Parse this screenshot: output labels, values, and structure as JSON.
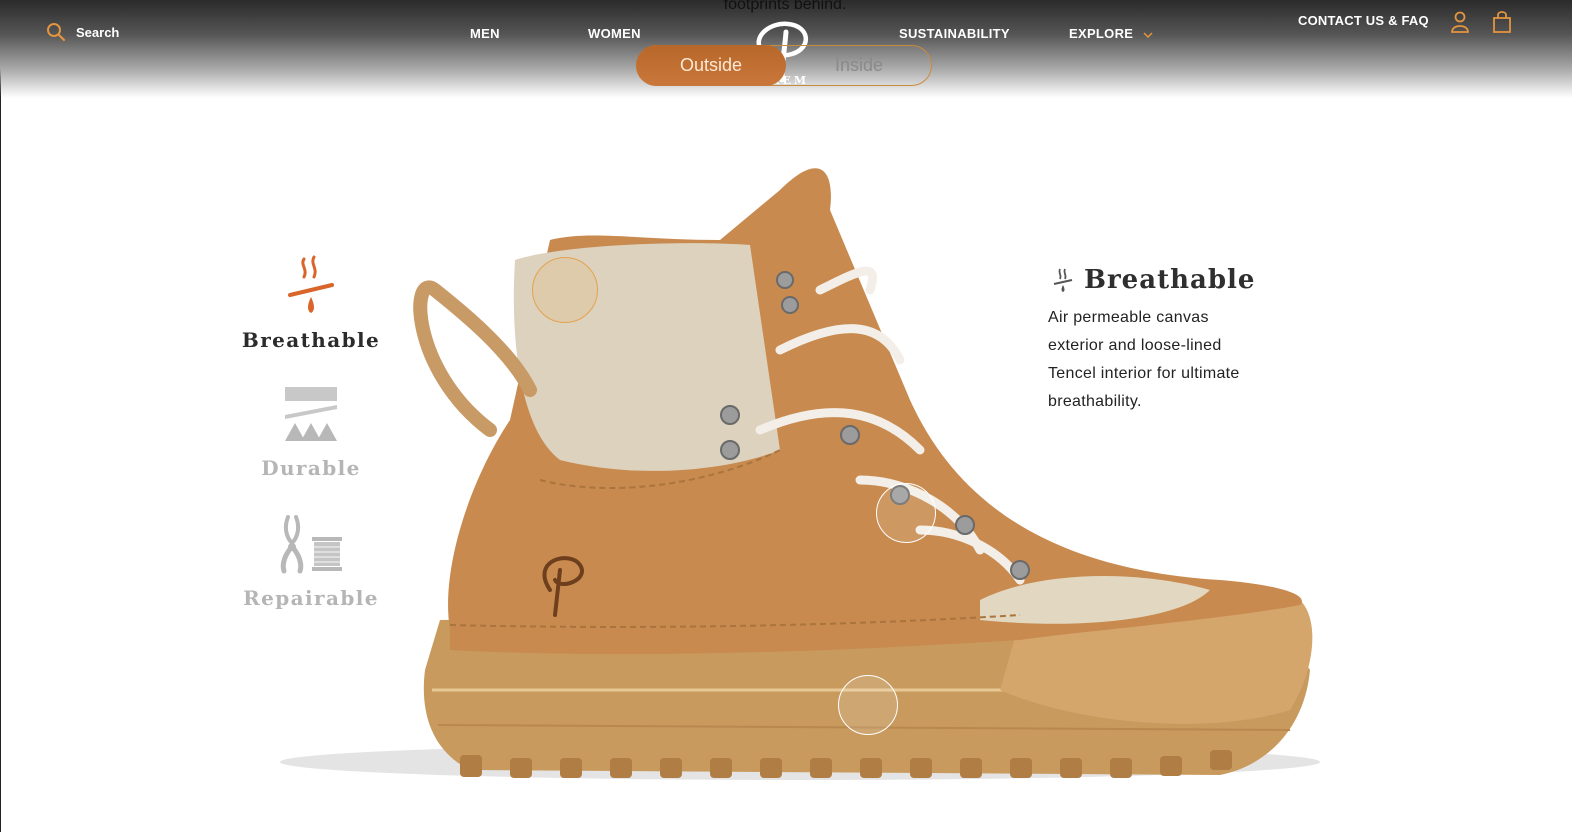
{
  "header": {
    "tagline": "footprints behind.",
    "search_label": "Search",
    "nav": {
      "men": "MEN",
      "women": "WOMEN",
      "sustainability": "SUSTAINABILITY",
      "explore": "EXPLORE"
    },
    "contact": "CONTACT US & FAQ",
    "logo_word": "EREM"
  },
  "toggle": {
    "outside_label": "Outside",
    "inside_label": "Inside",
    "selected": "Outside"
  },
  "features": [
    {
      "label": "Breathable",
      "active": true
    },
    {
      "label": "Durable",
      "active": false
    },
    {
      "label": "Repairable",
      "active": false
    }
  ],
  "detail": {
    "title": "Breathable",
    "text": "Air permeable canvas exterior and loose-lined Tencel interior for ultimate breathability."
  },
  "colors": {
    "accent": "#c9773a",
    "accent_icon": "#d9652b",
    "header_icon": "#e3943f",
    "muted": "#b5b5b5"
  },
  "icons": [
    "search-icon",
    "chevron-down-icon",
    "user-icon",
    "cart-icon",
    "breathable-icon",
    "durable-icon",
    "repairable-icon"
  ]
}
